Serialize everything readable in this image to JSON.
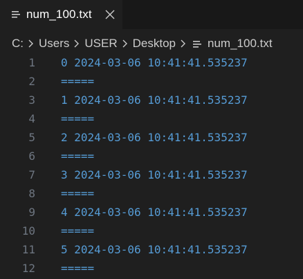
{
  "tab": {
    "label": "num_100.txt",
    "icon": "text-file-icon",
    "close_icon": "close-icon"
  },
  "breadcrumb": {
    "items": [
      "C:",
      "Users",
      "USER",
      "Desktop"
    ],
    "file_label": "num_100.txt",
    "separator_icon": "chevron-right-icon",
    "file_icon": "text-file-icon"
  },
  "editor": {
    "text_color": "#569cd6",
    "line_number_color": "#6e7681",
    "lines": [
      {
        "number": "1",
        "text": "0 2024-03-06 10:41:41.535237"
      },
      {
        "number": "2",
        "text": "====="
      },
      {
        "number": "3",
        "text": "1 2024-03-06 10:41:41.535237"
      },
      {
        "number": "4",
        "text": "====="
      },
      {
        "number": "5",
        "text": "2 2024-03-06 10:41:41.535237"
      },
      {
        "number": "6",
        "text": "====="
      },
      {
        "number": "7",
        "text": "3 2024-03-06 10:41:41.535237"
      },
      {
        "number": "8",
        "text": "====="
      },
      {
        "number": "9",
        "text": "4 2024-03-06 10:41:41.535237"
      },
      {
        "number": "10",
        "text": "====="
      },
      {
        "number": "11",
        "text": "5 2024-03-06 10:41:41.535237"
      },
      {
        "number": "12",
        "text": "====="
      }
    ]
  }
}
